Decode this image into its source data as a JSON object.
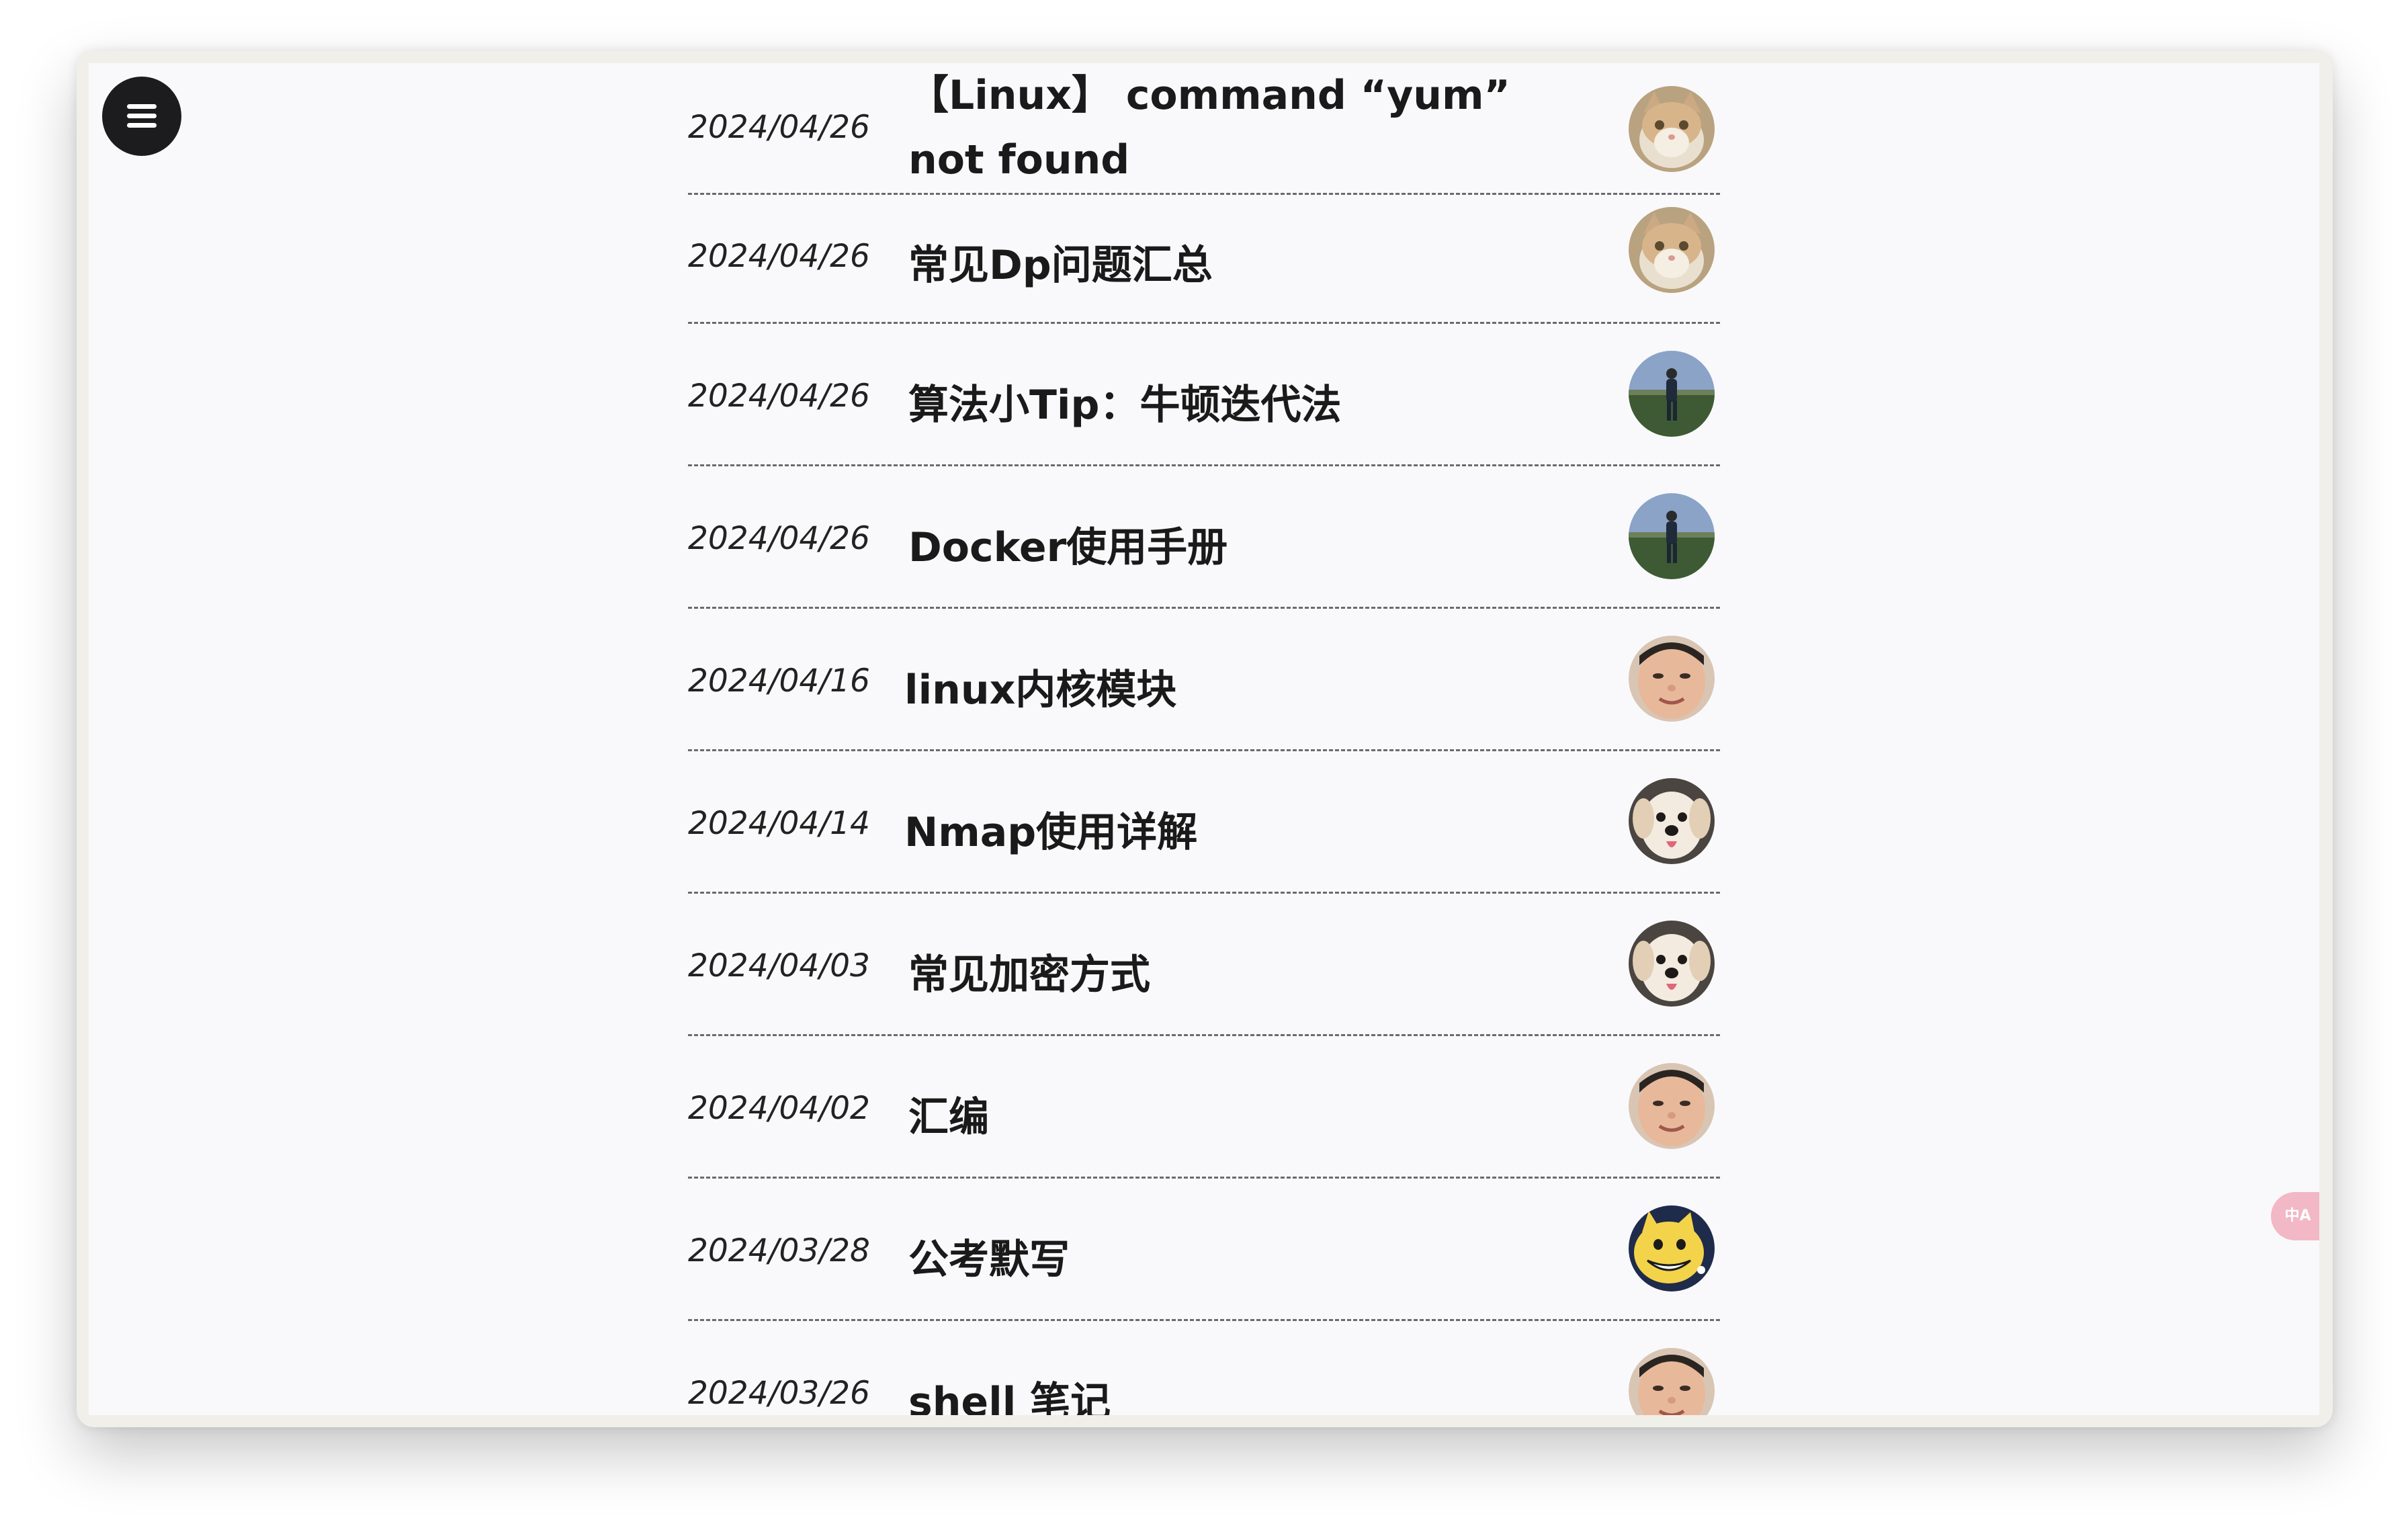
{
  "posts": [
    {
      "date": "2024/04/26",
      "title": "【Linux】 command “yum” not found",
      "avatar": "cat-avatar-icon"
    },
    {
      "date": "2024/04/26",
      "title": "常见Dp问题汇总",
      "avatar": "cat-avatar-icon"
    },
    {
      "date": "2024/04/26",
      "title": "算法小Tip：牛顿迭代法",
      "avatar": "person-field-avatar-icon"
    },
    {
      "date": "2024/04/26",
      "title": "Docker使用手册",
      "avatar": "person-field-avatar-icon"
    },
    {
      "date": "2024/04/16",
      "title": "linux内核模块",
      "avatar": "face-avatar-icon"
    },
    {
      "date": "2024/04/14",
      "title": "Nmap使用详解",
      "avatar": "puppy-avatar-icon"
    },
    {
      "date": "2024/04/03",
      "title": "常见加密方式",
      "avatar": "puppy-avatar-icon"
    },
    {
      "date": "2024/04/02",
      "title": "汇编",
      "avatar": "face-avatar-icon"
    },
    {
      "date": "2024/03/28",
      "title": "公考默写",
      "avatar": "cartoon-avatar-icon"
    },
    {
      "date": "2024/03/26",
      "title": "shell 笔记",
      "avatar": "face-avatar-icon"
    }
  ],
  "translate_tab": {
    "label": "中A"
  },
  "menu": {
    "icon": "hamburger-menu-icon"
  }
}
